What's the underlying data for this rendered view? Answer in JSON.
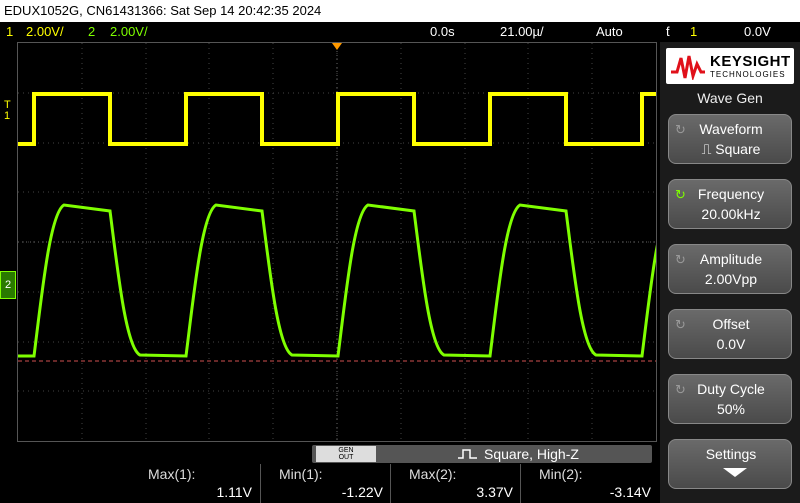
{
  "titlebar": {
    "text": "EDUX1052G, CN61431366: Sat Sep 14 20:42:35 2024"
  },
  "channels": {
    "ch1_num": "1",
    "ch1_scale": "2.00V/",
    "ch2_num": "2",
    "ch2_scale": "2.00V/",
    "time_offset": "0.0s",
    "time_scale": "21.00µ/",
    "trigger_mode": "Auto",
    "trigger_icon": "ƭ",
    "trigger_channel": "1",
    "trigger_level": "0.0V"
  },
  "markers": {
    "ch1": "1",
    "ch2": "2",
    "trigger": "T"
  },
  "panel": {
    "brand": "KEYSIGHT",
    "brand_sub": "TECHNOLOGIES",
    "title": "Wave Gen",
    "buttons": [
      {
        "label": "Waveform",
        "value": "⎍ Square"
      },
      {
        "label": "Frequency",
        "value": "20.00kHz"
      },
      {
        "label": "Amplitude",
        "value": "2.00Vpp"
      },
      {
        "label": "Offset",
        "value": "0.0V"
      },
      {
        "label": "Duty Cycle",
        "value": "50%"
      },
      {
        "label": "Settings",
        "value": ""
      }
    ]
  },
  "gen": {
    "out_label_1": "GEN",
    "out_label_2": "OUT",
    "status": "Square, High-Z"
  },
  "measurements": [
    {
      "name": "Max(1):",
      "value": "1.11V"
    },
    {
      "name": "Min(1):",
      "value": "-1.22V"
    },
    {
      "name": "Max(2):",
      "value": "3.37V"
    },
    {
      "name": "Min(2):",
      "value": "-3.14V"
    }
  ],
  "colors": {
    "ch1": "#ffff00",
    "ch2": "#7fff00",
    "ground": "#ff6666"
  }
}
